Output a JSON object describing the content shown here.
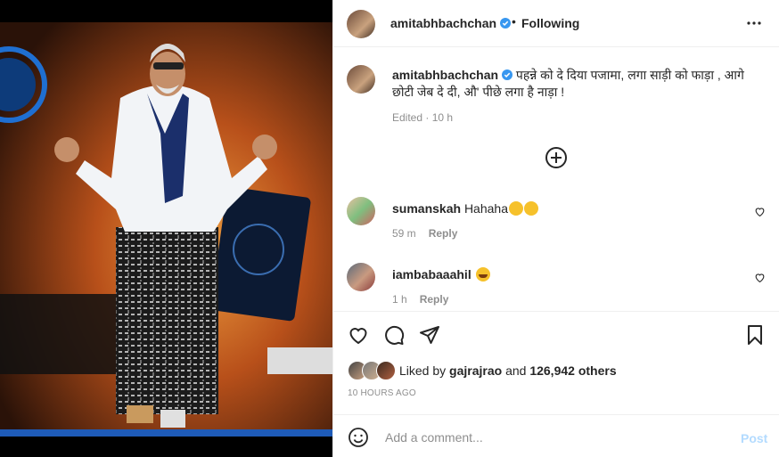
{
  "post": {
    "username": "amitabhbachchan",
    "dot": "•",
    "following_label": "Following"
  },
  "caption": {
    "username": "amitabhbachchan",
    "text": "पहन्ने को दे दिया पजामा, लगा साड़ी को फाड़ा , आगे छोटी जेब दे दी, औ' पीछे लगा है नाड़ा !",
    "edited": "Edited · 10 h"
  },
  "comments": [
    {
      "username": "sumanskah",
      "text": "Hahaha",
      "emojis": [
        "clapping-hands",
        "clapping-hands"
      ],
      "time": "59 m",
      "reply": "Reply"
    },
    {
      "username": "iambabaaahil",
      "text": "",
      "emojis": [
        "laughing-face"
      ],
      "time": "1 h",
      "reply": "Reply"
    }
  ],
  "likes": {
    "prefix": "Liked by",
    "user": "gajrajrao",
    "middle": "and",
    "others": "126,942 others"
  },
  "timestamp": "10 HOURS AGO",
  "add_comment": {
    "placeholder": "Add a comment...",
    "post_label": "Post"
  },
  "colors": {
    "verified": "#3897f0",
    "post_disabled": "#b3dbff",
    "meta_gray": "#8e8e8e",
    "stage_orange": "#d2691e"
  },
  "icons": [
    "verified-badge-icon",
    "more-options-icon",
    "load-more-icon",
    "heart-icon",
    "comment-icon",
    "share-icon",
    "bookmark-icon",
    "emoji-smile-icon"
  ]
}
